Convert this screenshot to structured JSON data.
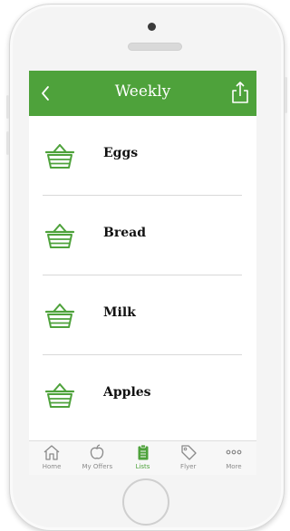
{
  "header": {
    "title": "Weekly"
  },
  "list": {
    "items": [
      {
        "label": "Eggs"
      },
      {
        "label": "Bread"
      },
      {
        "label": "Milk"
      },
      {
        "label": "Apples"
      }
    ]
  },
  "tabbar": {
    "tabs": [
      {
        "label": "Home",
        "icon": "home-icon"
      },
      {
        "label": "My Offers",
        "icon": "apple-icon"
      },
      {
        "label": "Lists",
        "icon": "clipboard-icon",
        "active": true
      },
      {
        "label": "Flyer",
        "icon": "tag-icon"
      },
      {
        "label": "More",
        "icon": "more-icon"
      }
    ]
  },
  "colors": {
    "brand_green": "#4ea23b",
    "tab_inactive": "#8a8a8a"
  }
}
